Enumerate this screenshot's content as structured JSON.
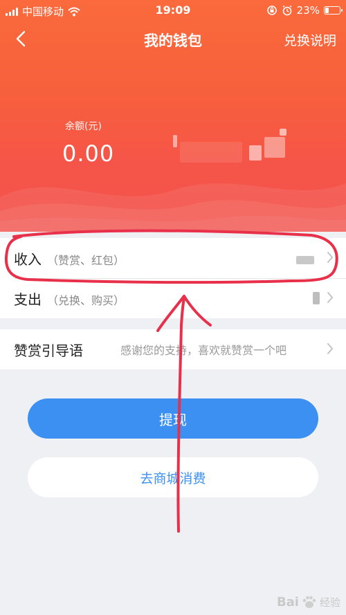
{
  "status_bar": {
    "carrier": "中国移动",
    "time": "19:09",
    "battery": "23%",
    "battery_level": 0.23
  },
  "nav": {
    "title": "我的钱包",
    "action": "兑换说明"
  },
  "balance": {
    "label": "余额(元)",
    "value": "0.00"
  },
  "list": {
    "income": {
      "label": "收入",
      "sub": "（赞赏、红包）"
    },
    "expense": {
      "label": "支出",
      "sub": "（兑换、购买）"
    },
    "tip": {
      "label": "赞赏引导语",
      "value": "感谢您的支持，喜欢就赞赏一个吧"
    }
  },
  "buttons": {
    "withdraw": "提现",
    "shop": "去商城消费"
  },
  "watermark": {
    "brand": "Bai",
    "sub": "经验"
  },
  "colors": {
    "header_top": "#fa6a3c",
    "header_bottom": "#f4524c",
    "primary": "#3c90f2",
    "annotation": "#e8304a"
  }
}
